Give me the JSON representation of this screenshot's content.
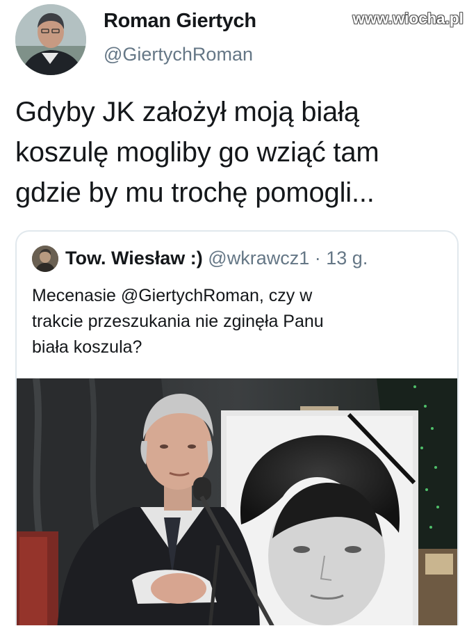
{
  "author": {
    "display_name": "Roman Giertych",
    "handle": "@GiertychRoman"
  },
  "watermark": "www.wiocha.pl",
  "tweet": {
    "text": "Gdyby JK założył moją białą\nkoszulę mogliby go wziąć tam\ngdzie by mu trochę pomogli..."
  },
  "quoted_tweet": {
    "display_name": "Tow. Wiesław :)",
    "handle": "@wkrawcz1",
    "separator": "·",
    "time": "13 g.",
    "text": "Mecenasie @GiertychRoman, czy w\ntrakcie przeszukania nie zginęła Panu\nbiała koszula?"
  },
  "colors": {
    "text_primary": "#14171a",
    "text_secondary": "#657786",
    "card_border": "#e1e8ed"
  }
}
